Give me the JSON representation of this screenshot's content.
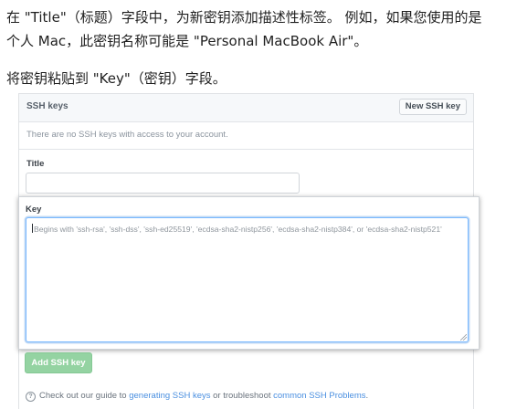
{
  "doc": {
    "para1_line1": "在 \"Title\"（标题）字段中，为新密钥添加描述性标签。 例如，如果您使用的是",
    "para1_line2": "个人 Mac，此密钥名称可能是 \"Personal MacBook Air\"。",
    "para2": "将密钥粘贴到 \"Key\"（密钥）字段。"
  },
  "panel": {
    "title": "SSH keys",
    "new_button": "New SSH key",
    "empty_message": "There are no SSH keys with access to your account.",
    "title_label": "Title",
    "title_value": "",
    "key_label": "Key",
    "key_placeholder": "Begins with 'ssh-rsa', 'ssh-dss', 'ssh-ed25519', 'ecdsa-sha2-nistp256', 'ecdsa-sha2-nistp384', or 'ecdsa-sha2-nistp521'",
    "add_button": "Add SSH key",
    "help_prefix": "Check out our guide to",
    "help_link1": "generating SSH keys",
    "help_middle": "or troubleshoot",
    "help_link2": "common SSH Problems",
    "help_suffix": "."
  },
  "icons": {
    "help": "question-circle-icon"
  },
  "colors": {
    "add_button_bg": "#94d3a2",
    "link": "#4a8fe0",
    "focus_border": "#79b8ff"
  }
}
